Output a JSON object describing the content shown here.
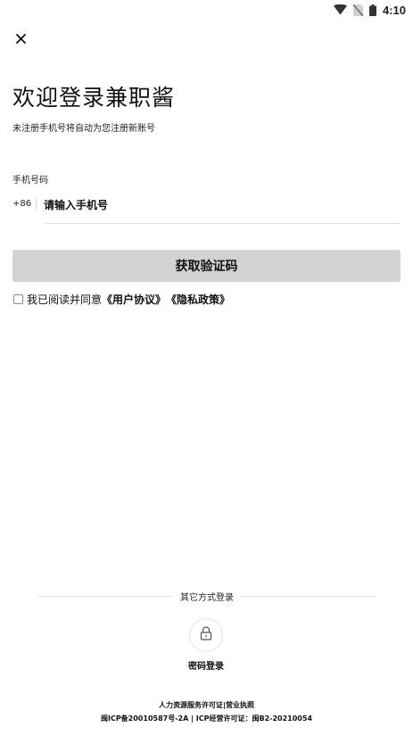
{
  "status_bar": {
    "time": "4:10",
    "icons": [
      "wifi-icon",
      "no-sim-icon",
      "battery-icon"
    ]
  },
  "header": {
    "close_icon": "close-icon",
    "title": "欢迎登录兼职酱",
    "subtitle": "未注册手机号将自动为您注册新账号"
  },
  "form": {
    "phone_label": "手机号码",
    "country_code": "+86",
    "phone_value": "",
    "phone_placeholder": "请输入手机号",
    "get_code_label": "获取验证码"
  },
  "agreement": {
    "checked": false,
    "prefix": "我已阅读并同意",
    "user_agreement": "《用户协议》",
    "privacy_policy": "《隐私政策》"
  },
  "other_login": {
    "label": "其它方式登录",
    "password_login_icon": "lock-icon",
    "password_login_label": "密码登录"
  },
  "footer": {
    "line1": "人力资源服务许可证|营业执照",
    "line2": "闽ICP备20010587号-2A | ICP经营许可证：闽B2-20210054"
  },
  "colors": {
    "button_bg": "#d2d2d2",
    "divider": "#e4e4e4",
    "text": "#111111"
  }
}
